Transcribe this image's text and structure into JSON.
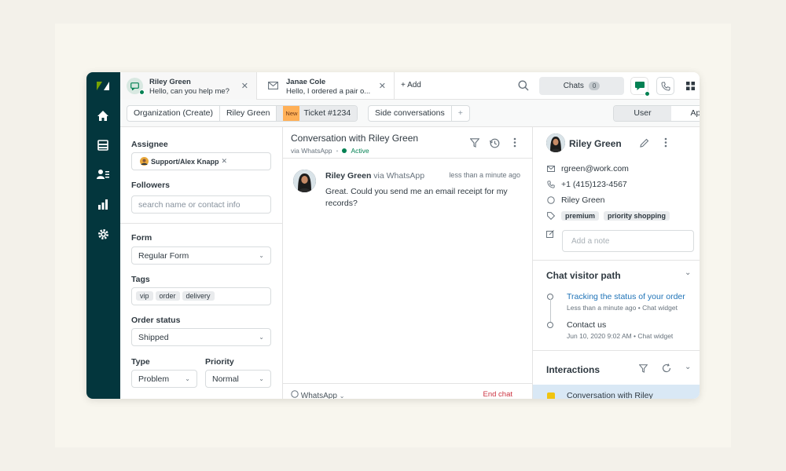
{
  "tabs": [
    {
      "name": "Riley Green",
      "preview": "Hello, can you help me?"
    },
    {
      "name": "Janae Cole",
      "preview": "Hello, I ordered a pair o..."
    }
  ],
  "topbar": {
    "add_label": "+ Add",
    "chats_label": "Chats",
    "chats_count": "0"
  },
  "breadcrumb": {
    "org": "Organization (Create)",
    "user": "Riley Green",
    "new_badge": "New",
    "ticket": "Ticket #1234",
    "side_conversations": "Side conversations",
    "plus": "+"
  },
  "context_tabs": {
    "user": "User",
    "apps": "Apps"
  },
  "ticket_fields": {
    "assignee_label": "Assignee",
    "assignee_value": "Support/Alex Knapp",
    "followers_label": "Followers",
    "followers_placeholder": "search name or contact info",
    "form_label": "Form",
    "form_value": "Regular Form",
    "tags_label": "Tags",
    "tags": [
      "vip",
      "order",
      "delivery"
    ],
    "order_status_label": "Order status",
    "order_status_value": "Shipped",
    "type_label": "Type",
    "type_value": "Problem",
    "priority_label": "Priority",
    "priority_value": "Normal"
  },
  "conversation": {
    "title": "Conversation with Riley Green",
    "via": "via WhatsApp",
    "status": "Active",
    "message": {
      "sender": "Riley Green",
      "via": "via WhatsApp",
      "time": "less than a minute ago",
      "text": "Great. Could you send me an email receipt for my records?"
    },
    "composer_channel": "WhatsApp",
    "end_chat": "End chat"
  },
  "customer": {
    "name": "Riley Green",
    "email": "rgreen@work.com",
    "phone": "+1 (415)123-4567",
    "whatsapp": "Riley Green",
    "tags": [
      "premium",
      "priority shopping"
    ],
    "note_placeholder": "Add a note"
  },
  "visitor_path": {
    "title": "Chat visitor path",
    "items": [
      {
        "title": "Tracking the status of your order",
        "meta": "Less than a minute ago • Chat widget"
      },
      {
        "title": "Contact us",
        "meta": "Jun 10, 2020 9:02 AM • Chat widget"
      }
    ]
  },
  "interactions": {
    "title": "Interactions",
    "items": [
      {
        "title": "Conversation with Riley"
      }
    ]
  },
  "colors": {
    "nav_bg": "#03363d",
    "accent_green": "#038153",
    "link_blue": "#1f73b7",
    "end_chat_red": "#cc3340",
    "new_badge": "#ffb057"
  },
  "icons": [
    "zendesk-logo",
    "home-icon",
    "views-icon",
    "customers-icon",
    "reporting-icon",
    "admin-gear-icon",
    "search-icon",
    "phone-icon",
    "apps-grid-icon",
    "filter-icon",
    "history-icon",
    "more-icon",
    "edit-icon"
  ]
}
